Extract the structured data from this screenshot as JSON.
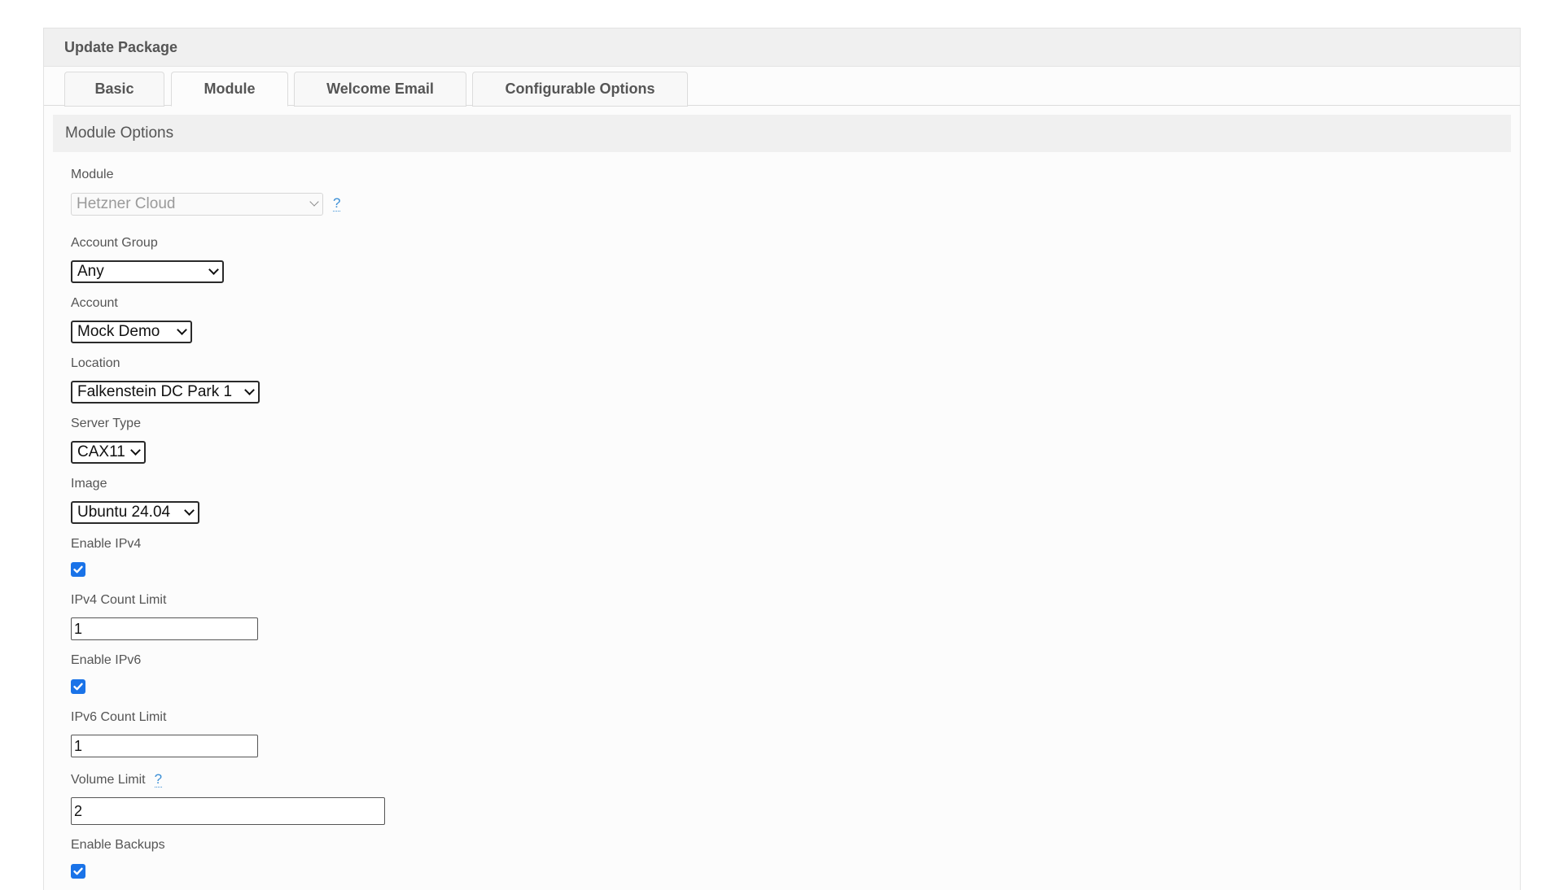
{
  "panel": {
    "title": "Update Package"
  },
  "tabs": [
    {
      "label": "Basic",
      "active": false
    },
    {
      "label": "Module",
      "active": true
    },
    {
      "label": "Welcome Email",
      "active": false
    },
    {
      "label": "Configurable Options",
      "active": false
    }
  ],
  "section": {
    "title": "Module Options"
  },
  "help_glyph": "?",
  "fields": {
    "module": {
      "label": "Module",
      "value": "Hetzner Cloud",
      "disabled": true
    },
    "account_group": {
      "label": "Account Group",
      "value": "Any"
    },
    "account": {
      "label": "Account",
      "value": "Mock Demo"
    },
    "location": {
      "label": "Location",
      "value": "Falkenstein DC Park 1"
    },
    "server_type": {
      "label": "Server Type",
      "value": "CAX11"
    },
    "image": {
      "label": "Image",
      "value": "Ubuntu 24.04"
    },
    "enable_ipv4": {
      "label": "Enable IPv4",
      "checked": true
    },
    "ipv4_count_limit": {
      "label": "IPv4 Count Limit",
      "value": "1"
    },
    "enable_ipv6": {
      "label": "Enable IPv6",
      "checked": true
    },
    "ipv6_count_limit": {
      "label": "IPv6 Count Limit",
      "value": "1"
    },
    "volume_limit": {
      "label": "Volume Limit",
      "value": "2"
    },
    "enable_backups": {
      "label": "Enable Backups",
      "checked": true
    }
  },
  "colors": {
    "checkbox": "#1a73e8",
    "help_link": "#3b8fd6",
    "header_bg": "#f0f0f0"
  }
}
